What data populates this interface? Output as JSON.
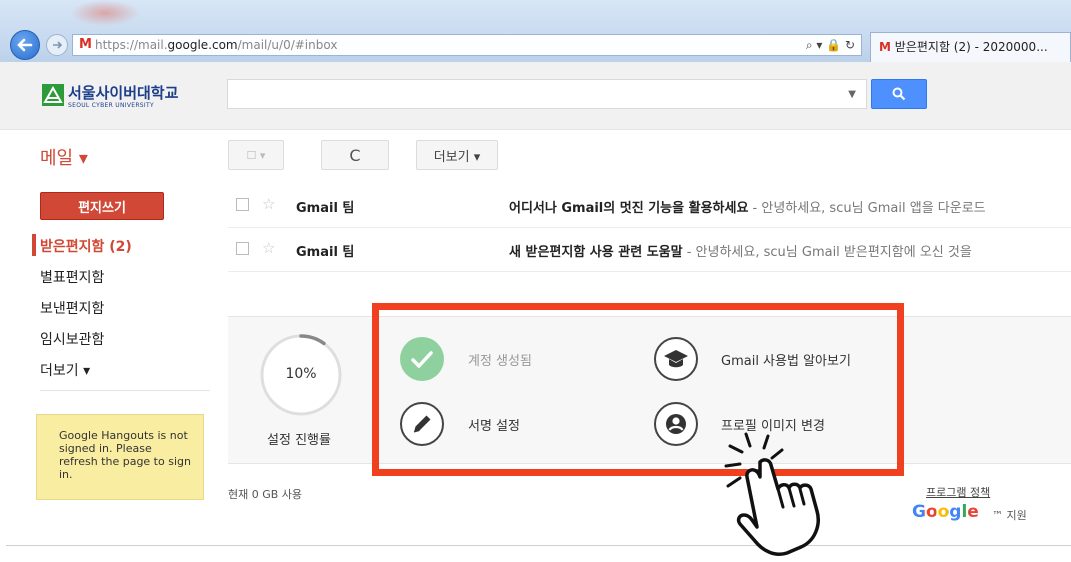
{
  "browser": {
    "url_prefix": "https://mail.",
    "url_domain": "google.com",
    "url_path": "/mail/u/0/#inbox",
    "address_controls": "⌕ ▾ 🔒 ↻",
    "tab_title": "받은편지함 (2) - 2020000..."
  },
  "header": {
    "logo_name": "서울사이버대학교",
    "logo_sub": "SEOUL CYBER UNIVERSITY",
    "search_value": ""
  },
  "toolbar": {
    "mail_label": "메일 ▾",
    "select_label": "☐ ▾",
    "refresh_label": "C",
    "more_label": "더보기 ▾"
  },
  "sidebar": {
    "compose_label": "편지쓰기",
    "items": [
      {
        "label": "받은편지함 (2)"
      },
      {
        "label": "별표편지함"
      },
      {
        "label": "보낸편지함"
      },
      {
        "label": "임시보관함"
      },
      {
        "label": "더보기 ▾"
      }
    ],
    "hangouts_notice": "Google Hangouts is not signed in. Please refresh the page to sign in."
  },
  "messages": [
    {
      "sender": "Gmail 팀",
      "subject": "어디서나 Gmail의 멋진 기능을 활용하세요",
      "snippet": " - 안녕하세요, scu님 Gmail 앱을 다운로드"
    },
    {
      "sender": "Gmail 팀",
      "subject": "새 받은편지함 사용 관련 도움말",
      "snippet": " - 안녕하세요, scu님 Gmail 받은편지함에 오신 것을"
    }
  ],
  "setup": {
    "progress_percent": "10%",
    "progress_value": 0.1,
    "progress_label": "설정 진행률",
    "tasks": [
      {
        "label": "계정 생성됨",
        "icon": "check-icon",
        "done": true
      },
      {
        "label": "Gmail 사용법 알아보기",
        "icon": "graduation-cap-icon",
        "done": false
      },
      {
        "label": "서명 설정",
        "icon": "pencil-icon",
        "done": false
      },
      {
        "label": "프로필 이미지 변경",
        "icon": "person-icon",
        "done": false
      }
    ]
  },
  "footer": {
    "storage": "현재 0 GB 사용",
    "program_policy": "프로그램 정책",
    "google_logo": "Google",
    "support": "™ 지원"
  },
  "colors": {
    "accent_red": "#d14836",
    "highlight_frame": "#f0401f",
    "search_blue": "#4d90fe",
    "done_green": "#8fd19e"
  }
}
